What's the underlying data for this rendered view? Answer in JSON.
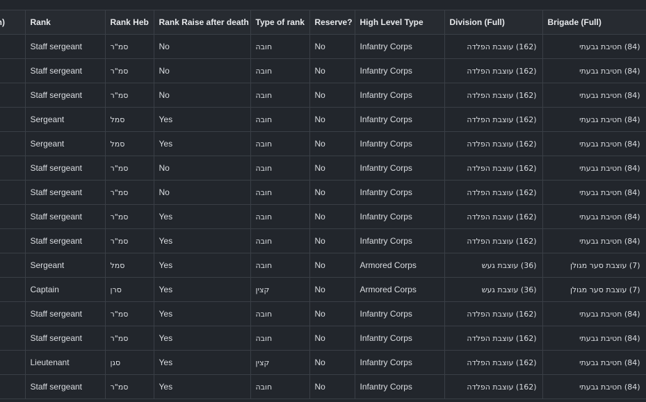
{
  "columns": [
    "tion)",
    "Rank",
    "Rank Heb",
    "Rank Raise after death",
    "Type of rank",
    "Reserve?",
    "High Level Type",
    "Division (Full)",
    "Brigade (Full)"
  ],
  "rows": [
    [
      "",
      "Staff sergeant",
      "סמ\"ר",
      "No",
      "חובה",
      "No",
      "Infantry Corps",
      "(162) עוצבת הפלדה",
      "(84) חטיבת גבעתי"
    ],
    [
      "",
      "Staff sergeant",
      "סמ\"ר",
      "No",
      "חובה",
      "No",
      "Infantry Corps",
      "(162) עוצבת הפלדה",
      "(84) חטיבת גבעתי"
    ],
    [
      "",
      "Staff sergeant",
      "סמ\"ר",
      "No",
      "חובה",
      "No",
      "Infantry Corps",
      "(162) עוצבת הפלדה",
      "(84) חטיבת גבעתי"
    ],
    [
      "",
      "Sergeant",
      "סמל",
      "Yes",
      "חובה",
      "No",
      "Infantry Corps",
      "(162) עוצבת הפלדה",
      "(84) חטיבת גבעתי"
    ],
    [
      "",
      "Sergeant",
      "סמל",
      "Yes",
      "חובה",
      "No",
      "Infantry Corps",
      "(162) עוצבת הפלדה",
      "(84) חטיבת גבעתי"
    ],
    [
      "",
      "Staff sergeant",
      "סמ\"ר",
      "No",
      "חובה",
      "No",
      "Infantry Corps",
      "(162) עוצבת הפלדה",
      "(84) חטיבת גבעתי"
    ],
    [
      "",
      "Staff sergeant",
      "סמ\"ר",
      "No",
      "חובה",
      "No",
      "Infantry Corps",
      "(162) עוצבת הפלדה",
      "(84) חטיבת גבעתי"
    ],
    [
      "",
      "Staff sergeant",
      "סמ\"ר",
      "Yes",
      "חובה",
      "No",
      "Infantry Corps",
      "(162) עוצבת הפלדה",
      "(84) חטיבת גבעתי"
    ],
    [
      "",
      "Staff sergeant",
      "סמ\"ר",
      "Yes",
      "חובה",
      "No",
      "Infantry Corps",
      "(162) עוצבת הפלדה",
      "(84) חטיבת גבעתי"
    ],
    [
      "",
      "Sergeant",
      "סמל",
      "Yes",
      "חובה",
      "No",
      "Armored Corps",
      "(36) עוצבת געש",
      "(7) עוצבת סער מגולן"
    ],
    [
      "",
      "Captain",
      "סרן",
      "Yes",
      "קצין",
      "No",
      "Armored Corps",
      "(36) עוצבת געש",
      "(7) עוצבת סער מגולן"
    ],
    [
      "",
      "Staff sergeant",
      "סמ\"ר",
      "Yes",
      "חובה",
      "No",
      "Infantry Corps",
      "(162) עוצבת הפלדה",
      "(84) חטיבת גבעתי"
    ],
    [
      "",
      "Staff sergeant",
      "סמ\"ר",
      "Yes",
      "חובה",
      "No",
      "Infantry Corps",
      "(162) עוצבת הפלדה",
      "(84) חטיבת גבעתי"
    ],
    [
      "",
      "Lieutenant",
      "סגן",
      "Yes",
      "קצין",
      "No",
      "Infantry Corps",
      "(162) עוצבת הפלדה",
      "(84) חטיבת גבעתי"
    ],
    [
      "",
      "Staff sergeant",
      "סמ\"ר",
      "Yes",
      "חובה",
      "No",
      "Infantry Corps",
      "(162) עוצבת הפלדה",
      "(84) חטיבת גבעתי"
    ]
  ]
}
